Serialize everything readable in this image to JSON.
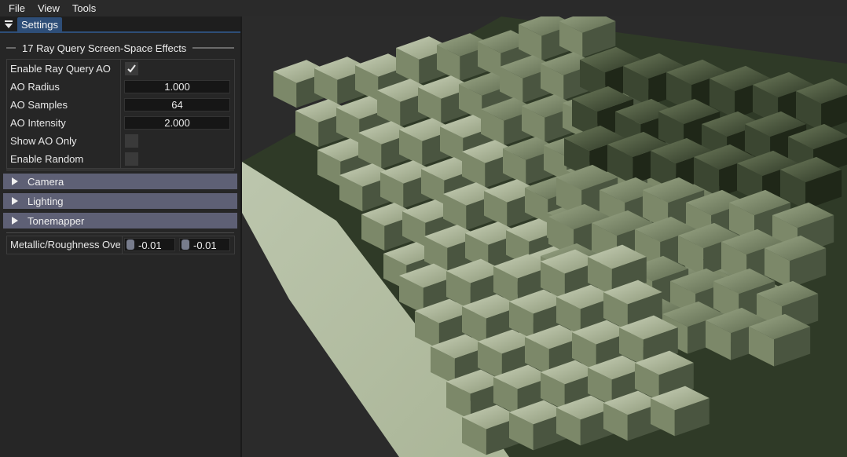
{
  "menu": [
    "File",
    "View",
    "Tools"
  ],
  "panel": {
    "tab_label": "Settings",
    "section_title": "17 Ray Query Screen-Space Effects",
    "props": [
      {
        "label": "Enable Ray Query AO",
        "kind": "check",
        "checked": true
      },
      {
        "label": "AO Radius",
        "kind": "field",
        "value": "1.000"
      },
      {
        "label": "AO Samples",
        "kind": "field",
        "value": "64"
      },
      {
        "label": "AO Intensity",
        "kind": "field",
        "value": "2.000"
      },
      {
        "label": "Show AO Only",
        "kind": "check",
        "checked": false
      },
      {
        "label": "Enable Random",
        "kind": "check",
        "checked": false
      }
    ],
    "collapsibles": [
      "Camera",
      "Lighting",
      "Tonemapper"
    ],
    "metal_rough": {
      "label": "Metallic/Roughness Override",
      "metallic": "-0.01",
      "roughness": "-0.01"
    }
  },
  "colors": {
    "accent_tab": "#2e4e78",
    "header_bg": "#5e6075",
    "cube_tint": "#a9b694"
  },
  "viewport": {
    "scene": "3d-voxel-terrain"
  }
}
